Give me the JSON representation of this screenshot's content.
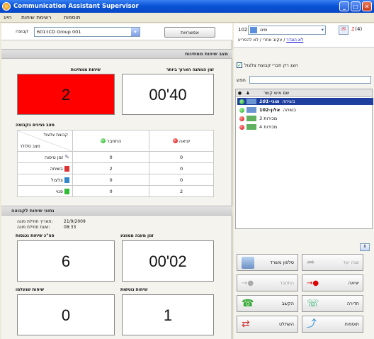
{
  "window": {
    "title": "Communication Assistant Supervisor"
  },
  "menu": [
    "חייג",
    "רשימת שיחות",
    "תוספות"
  ],
  "toolbar": {
    "group_label": "קבוצה",
    "group_value": "601:ICD Group 001",
    "permissions_button": "אפשרויות"
  },
  "section_calls": "מצב שיחות ממתינות",
  "waiting_calls": {
    "label": "שיחות ממתינות",
    "value": "2"
  },
  "longest_wait": {
    "label": "זמן המתנה הארוך ביותר",
    "value": "00'40"
  },
  "agents_section": "מצב נציגים בקבוצה",
  "agents_table": {
    "corner_top": "קבוצת צלצול",
    "corner_bottom": "מצב סלולר",
    "col_connected": "התחבר",
    "col_exit": "יציאה",
    "rows": [
      {
        "label": "זמן טיפוה",
        "connected": "0",
        "exit": "0"
      },
      {
        "label": "בשיחה",
        "connected": "2",
        "exit": "0"
      },
      {
        "label": "צלצול",
        "connected": "0",
        "exit": "0"
      },
      {
        "label": "פנוי",
        "connected": "0",
        "exit": "2"
      }
    ]
  },
  "stats_section": "נתוני שיחות לקבוצה",
  "stats_meta": {
    "date_label": "תאריך תחילת מונה:",
    "date_value": "21/9/2009",
    "time_label": "שעת תחילת מונה:",
    "time_value": "08:33"
  },
  "answered_calls": {
    "label": "סה\"כ שיחות נכנסות",
    "value": "6"
  },
  "avg_wait": {
    "label": "זמן מענה ממוצע",
    "value": "00'02"
  },
  "abandoned_calls": {
    "label": "שיחות שנעלמו",
    "value": "0"
  },
  "outgoing_calls": {
    "label": "שיחות נוטשות",
    "value": "1"
  },
  "right_panel": {
    "extension": "102",
    "user_name": "מינו",
    "badge_count": "(4)",
    "link_disconnected": "לא הוגדר",
    "link_text": "/ עקוב אחרי / לא להפריע",
    "show_members": "הצג רק חברי קבוצת צלצול",
    "search_label": "חפש",
    "col_contact": "שם איש קשר",
    "contacts": [
      {
        "status": "בשיחה",
        "name": "מוני-101",
        "dot": "green",
        "selected": true
      },
      {
        "status": "בשיחה",
        "name": "אלון-102",
        "dot": "green",
        "selected": false
      },
      {
        "status": "",
        "name": "מכירות 3",
        "dot": "red",
        "selected": false
      },
      {
        "status": "",
        "name": "מכירות 4",
        "dot": "red",
        "selected": false
      }
    ],
    "buttons": {
      "mobile_share": "סלפון משרד",
      "sent_to": "שנה יעד",
      "connect": "התחבר",
      "exit": "יציאה",
      "call": "הקשב",
      "listen": "חדירה",
      "transfer": "השתלט",
      "add": "תוספות"
    }
  },
  "colors": {
    "alert_red": "#ff0000",
    "title_blue": "#0a54d6",
    "selected_row": "#1f3fa0"
  }
}
